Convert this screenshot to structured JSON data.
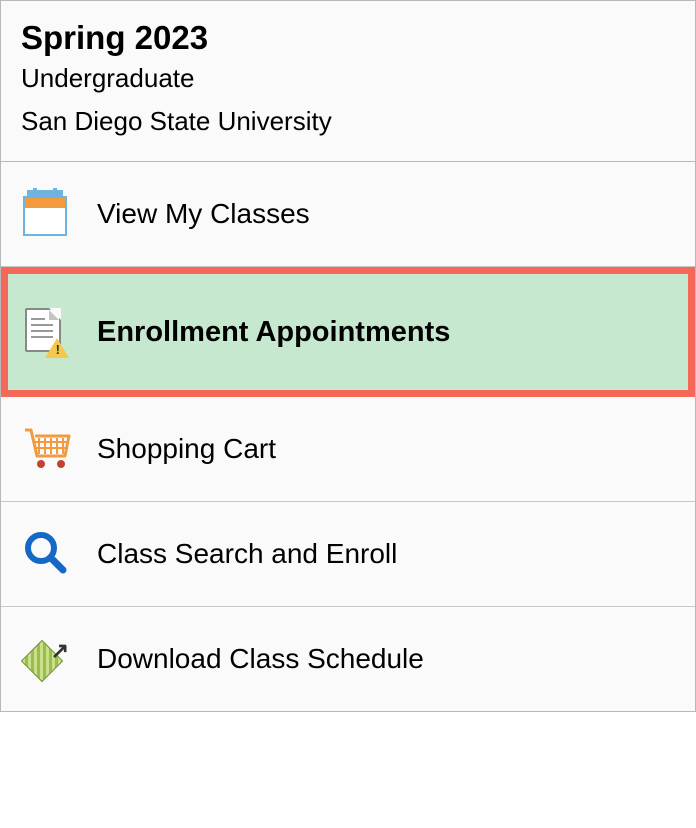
{
  "header": {
    "term": "Spring 2023",
    "career": "Undergraduate",
    "institution": "San Diego State University"
  },
  "menu": {
    "view_classes": "View My Classes",
    "enrollment_appointments": "Enrollment Appointments",
    "shopping_cart": "Shopping Cart",
    "class_search": "Class Search and Enroll",
    "download_schedule": "Download Class Schedule"
  }
}
